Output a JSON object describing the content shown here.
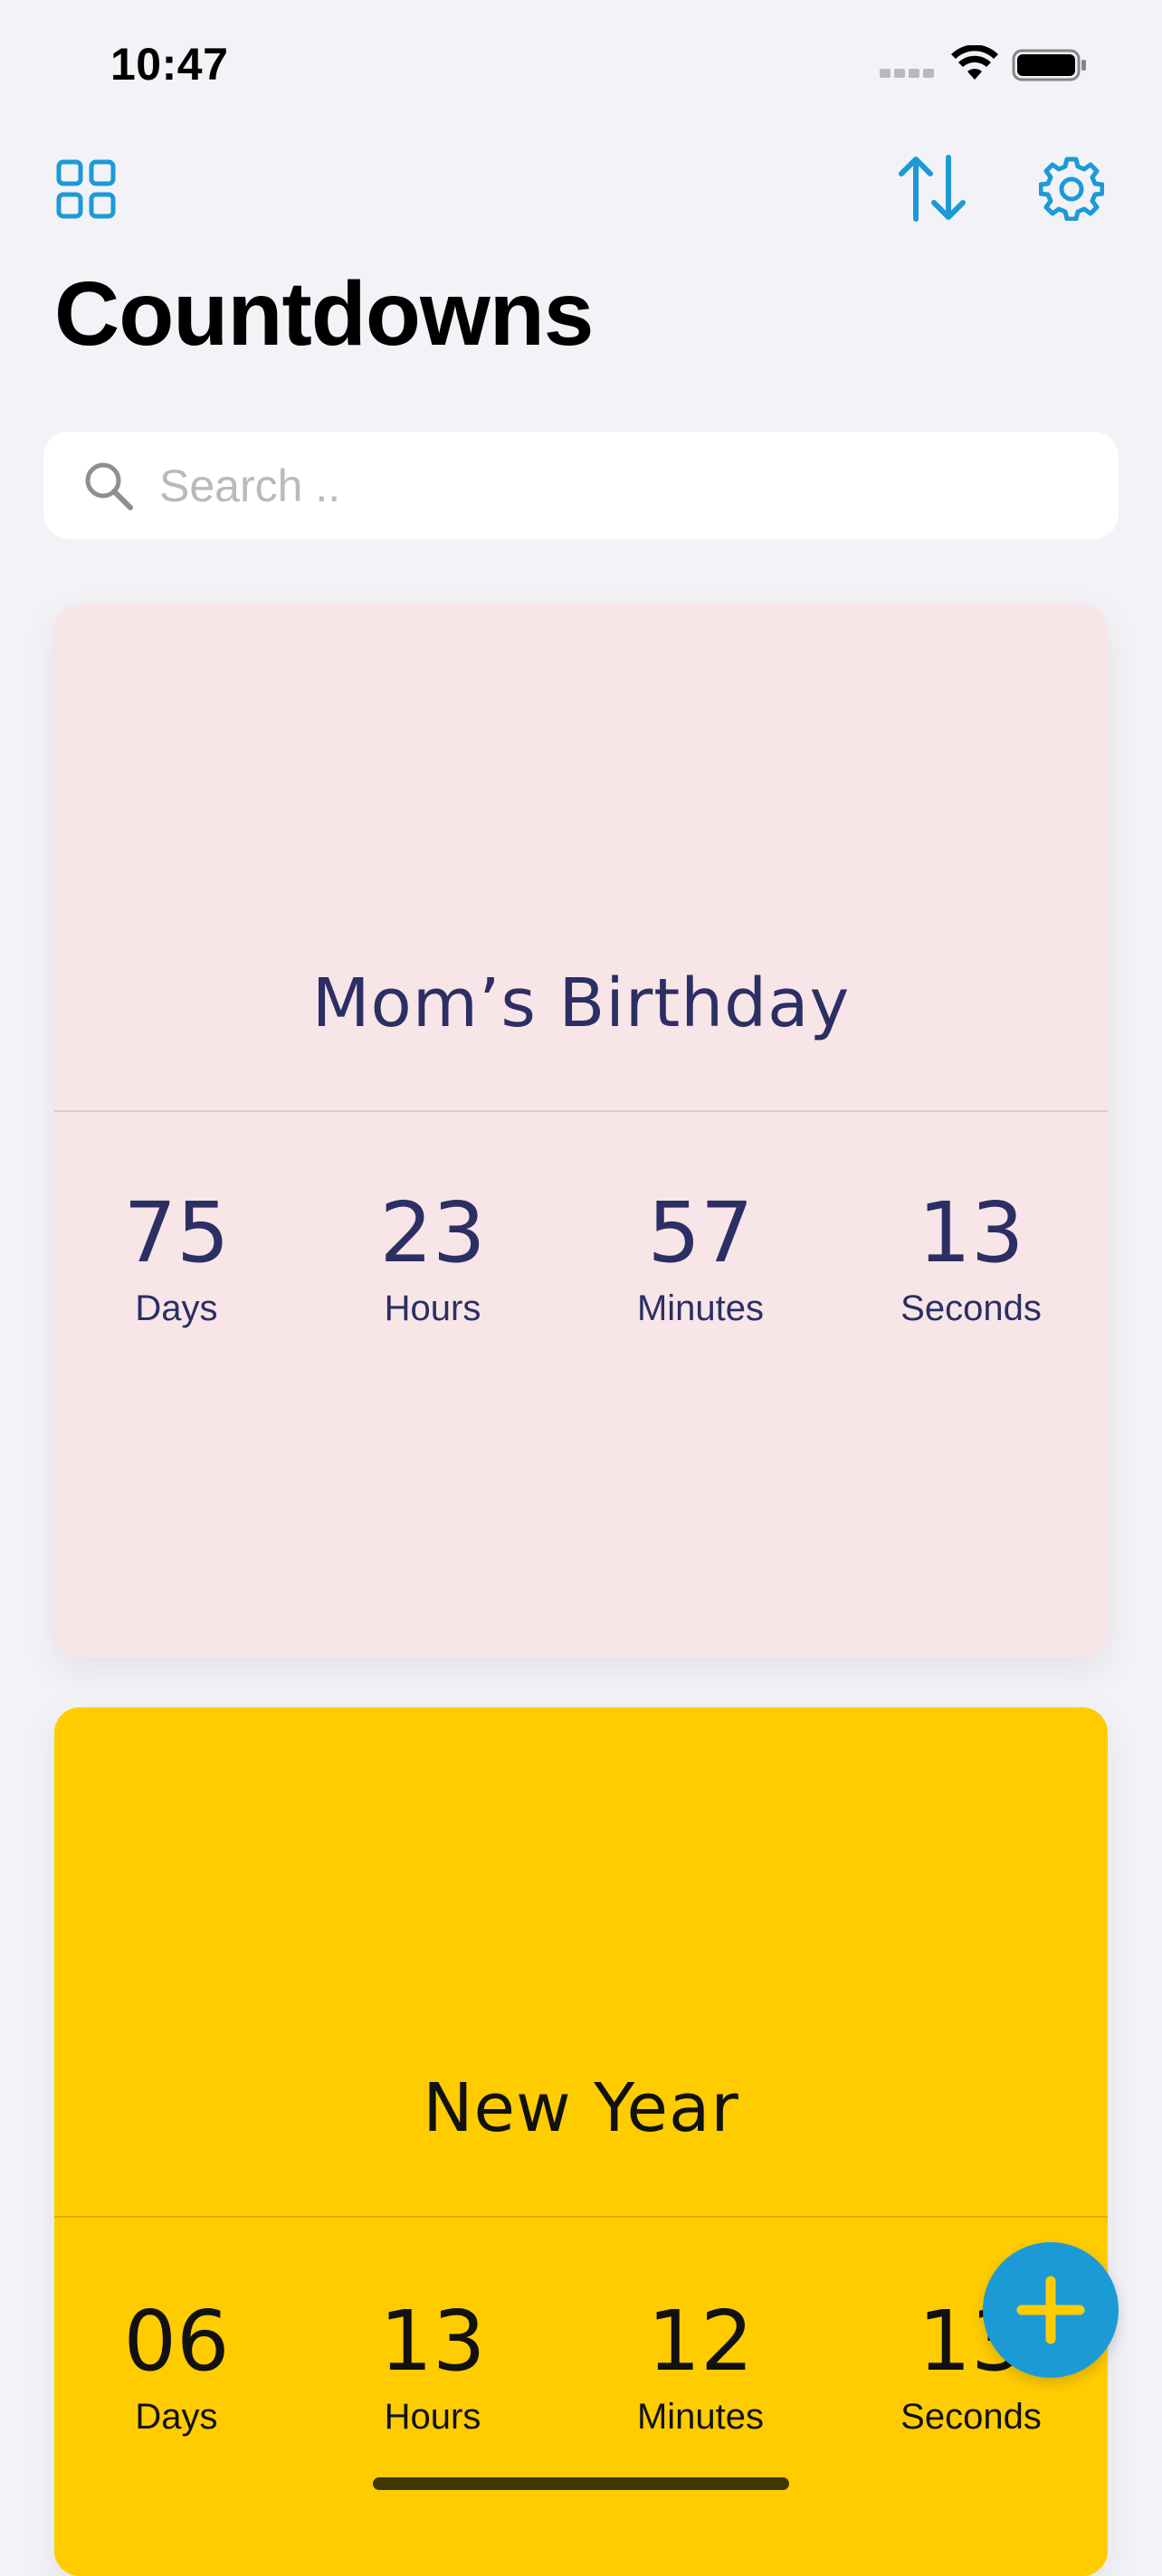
{
  "status_bar": {
    "time": "10:47"
  },
  "header": {
    "title": "Countdowns",
    "left_icon": "grid-icon",
    "right_icons": [
      "sort-icon",
      "gear-icon"
    ]
  },
  "search": {
    "placeholder": "Search ..",
    "value": ""
  },
  "countdowns": [
    {
      "title": "Mom’s Birthday",
      "background": "#f8e5e7",
      "text_color": "#2b2f63",
      "units": [
        {
          "value": "75",
          "label": "Days"
        },
        {
          "value": "23",
          "label": "Hours"
        },
        {
          "value": "57",
          "label": "Minutes"
        },
        {
          "value": "13",
          "label": "Seconds"
        }
      ]
    },
    {
      "title": "New Year",
      "background": "#ffcc00",
      "text_color": "#111111",
      "units": [
        {
          "value": "06",
          "label": "Days"
        },
        {
          "value": "13",
          "label": "Hours"
        },
        {
          "value": "12",
          "label": "Minutes"
        },
        {
          "value": "13",
          "label": "Seconds"
        }
      ]
    }
  ],
  "fab": {
    "icon": "plus-icon",
    "color": "#1c9ad6",
    "icon_color": "#ffcc00"
  },
  "accent_color": "#1c9ad6"
}
